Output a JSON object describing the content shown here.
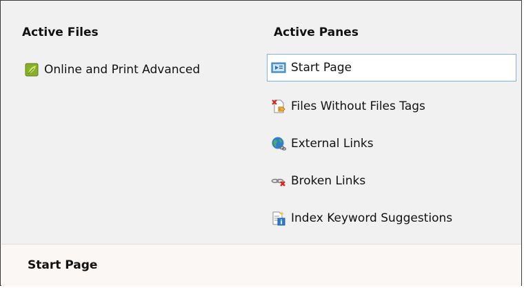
{
  "active_files": {
    "heading": "Active Files",
    "items": [
      {
        "label": "Online and Print Advanced",
        "icon": "project-file-icon"
      }
    ]
  },
  "active_panes": {
    "heading": "Active Panes",
    "selected_index": 0,
    "items": [
      {
        "label": "Start Page",
        "icon": "start-page-icon"
      },
      {
        "label": "Files Without Files Tags",
        "icon": "file-tag-missing-icon"
      },
      {
        "label": "External Links",
        "icon": "globe-link-icon"
      },
      {
        "label": "Broken Links",
        "icon": "broken-link-icon"
      },
      {
        "label": "Index Keyword Suggestions",
        "icon": "index-keyword-icon"
      }
    ]
  },
  "footer": {
    "title": "Start Page"
  },
  "colors": {
    "selection_border": "#7fb2e6",
    "panel_background": "#f1f1f1",
    "footer_background": "#fbf7f5"
  }
}
